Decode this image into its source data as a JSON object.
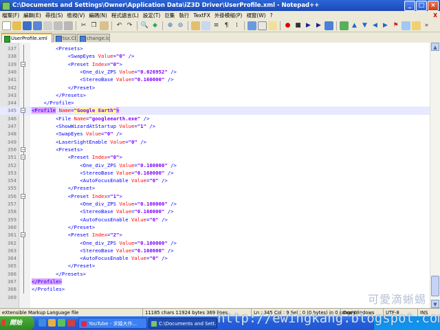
{
  "window": {
    "title": "C:\\Documents and Settings\\Owner\\Application Data\\iZ3D Driver\\UserProfile.xml - Notepad++"
  },
  "menu": {
    "items": [
      "檔案(F)",
      "編輯(E)",
      "尋找(S)",
      "檢視(V)",
      "編碼(N)",
      "程式語言(L)",
      "設定(T)",
      "巨集",
      "執行",
      "TextFX",
      "外掛模組(P)",
      "視窗(W)",
      "?"
    ],
    "close_label": "X"
  },
  "tabs": [
    {
      "label": "UserProfile.xml",
      "active": true
    },
    {
      "label": "tsx.CFG",
      "active": false
    },
    {
      "label": "change.log",
      "active": false
    }
  ],
  "editor": {
    "current_line": 345,
    "lines": [
      {
        "num": 337,
        "segs": [
          {
            "c": "t",
            "x": "        <Presets>"
          }
        ]
      },
      {
        "num": 338,
        "segs": [
          {
            "c": "t",
            "x": "            <SwapEyes "
          },
          {
            "c": "a",
            "x": "Value"
          },
          {
            "c": "t",
            "x": "="
          },
          {
            "c": "v",
            "x": "\"0\""
          },
          {
            "c": "t",
            "x": " />"
          }
        ]
      },
      {
        "num": 339,
        "segs": [
          {
            "c": "t",
            "x": "            <Preset "
          },
          {
            "c": "a",
            "x": "Index"
          },
          {
            "c": "t",
            "x": "="
          },
          {
            "c": "v",
            "x": "\"0\""
          },
          {
            "c": "t",
            "x": ">"
          }
        ]
      },
      {
        "num": 340,
        "segs": [
          {
            "c": "t",
            "x": "                <One_div_ZPS "
          },
          {
            "c": "a",
            "x": "Value"
          },
          {
            "c": "t",
            "x": "="
          },
          {
            "c": "v",
            "x": "\"0.026952\""
          },
          {
            "c": "t",
            "x": " />"
          }
        ]
      },
      {
        "num": 341,
        "segs": [
          {
            "c": "t",
            "x": "                <StereoBase "
          },
          {
            "c": "a",
            "x": "Value"
          },
          {
            "c": "t",
            "x": "="
          },
          {
            "c": "v",
            "x": "\"0.160000\""
          },
          {
            "c": "t",
            "x": " />"
          }
        ]
      },
      {
        "num": 342,
        "segs": [
          {
            "c": "t",
            "x": "            </Preset>"
          }
        ]
      },
      {
        "num": 343,
        "segs": [
          {
            "c": "t",
            "x": "        </Presets>"
          }
        ]
      },
      {
        "num": 344,
        "segs": [
          {
            "c": "t",
            "x": "    </Profile>"
          }
        ]
      },
      {
        "num": 345,
        "segs": [
          {
            "c": "th",
            "x": "<Profile"
          },
          {
            "c": "t",
            "x": " "
          },
          {
            "c": "a",
            "x": "Name"
          },
          {
            "c": "t",
            "x": "="
          },
          {
            "c": "vh",
            "x": "\"Google Earth\""
          },
          {
            "c": "th",
            "x": ">"
          }
        ]
      },
      {
        "num": 346,
        "segs": [
          {
            "c": "t",
            "x": "        <File "
          },
          {
            "c": "a",
            "x": "Name"
          },
          {
            "c": "t",
            "x": "="
          },
          {
            "c": "v",
            "x": "\"googleearth.exe\""
          },
          {
            "c": "t",
            "x": " />"
          }
        ]
      },
      {
        "num": 347,
        "segs": [
          {
            "c": "t",
            "x": "        <ShowWizardAtStartup "
          },
          {
            "c": "a",
            "x": "Value"
          },
          {
            "c": "t",
            "x": "="
          },
          {
            "c": "v",
            "x": "\"1\""
          },
          {
            "c": "t",
            "x": " />"
          }
        ]
      },
      {
        "num": 348,
        "segs": [
          {
            "c": "t",
            "x": "        <SwapEyes "
          },
          {
            "c": "a",
            "x": "Value"
          },
          {
            "c": "t",
            "x": "="
          },
          {
            "c": "v",
            "x": "\"0\""
          },
          {
            "c": "t",
            "x": " />"
          }
        ]
      },
      {
        "num": 349,
        "segs": [
          {
            "c": "t",
            "x": "        <LaserSightEnable "
          },
          {
            "c": "a",
            "x": "Value"
          },
          {
            "c": "t",
            "x": "="
          },
          {
            "c": "v",
            "x": "\"0\""
          },
          {
            "c": "t",
            "x": " />"
          }
        ]
      },
      {
        "num": 350,
        "segs": [
          {
            "c": "t",
            "x": "        <Presets>"
          }
        ]
      },
      {
        "num": 351,
        "segs": [
          {
            "c": "t",
            "x": "            <Preset "
          },
          {
            "c": "a",
            "x": "Index"
          },
          {
            "c": "t",
            "x": "="
          },
          {
            "c": "v",
            "x": "\"0\""
          },
          {
            "c": "t",
            "x": ">"
          }
        ]
      },
      {
        "num": 352,
        "segs": [
          {
            "c": "t",
            "x": "                <One_div_ZPS "
          },
          {
            "c": "a",
            "x": "Value"
          },
          {
            "c": "t",
            "x": "="
          },
          {
            "c": "v",
            "x": "\"0.100000\""
          },
          {
            "c": "t",
            "x": " />"
          }
        ]
      },
      {
        "num": 353,
        "segs": [
          {
            "c": "t",
            "x": "                <StereoBase "
          },
          {
            "c": "a",
            "x": "Value"
          },
          {
            "c": "t",
            "x": "="
          },
          {
            "c": "v",
            "x": "\"0.160000\""
          },
          {
            "c": "t",
            "x": " />"
          }
        ]
      },
      {
        "num": 354,
        "segs": [
          {
            "c": "t",
            "x": "                <AutoFocusEnable "
          },
          {
            "c": "a",
            "x": "Value"
          },
          {
            "c": "t",
            "x": "="
          },
          {
            "c": "v",
            "x": "\"0\""
          },
          {
            "c": "t",
            "x": " />"
          }
        ]
      },
      {
        "num": 355,
        "segs": [
          {
            "c": "t",
            "x": "            </Preset>"
          }
        ]
      },
      {
        "num": 356,
        "segs": [
          {
            "c": "t",
            "x": "            <Preset "
          },
          {
            "c": "a",
            "x": "Index"
          },
          {
            "c": "t",
            "x": "="
          },
          {
            "c": "v",
            "x": "\"1\""
          },
          {
            "c": "t",
            "x": ">"
          }
        ]
      },
      {
        "num": 357,
        "segs": [
          {
            "c": "t",
            "x": "                <One_div_ZPS "
          },
          {
            "c": "a",
            "x": "Value"
          },
          {
            "c": "t",
            "x": "="
          },
          {
            "c": "v",
            "x": "\"0.100000\""
          },
          {
            "c": "t",
            "x": " />"
          }
        ]
      },
      {
        "num": 358,
        "segs": [
          {
            "c": "t",
            "x": "                <StereoBase "
          },
          {
            "c": "a",
            "x": "Value"
          },
          {
            "c": "t",
            "x": "="
          },
          {
            "c": "v",
            "x": "\"0.160000\""
          },
          {
            "c": "t",
            "x": " />"
          }
        ]
      },
      {
        "num": 359,
        "segs": [
          {
            "c": "t",
            "x": "                <AutoFocusEnable "
          },
          {
            "c": "a",
            "x": "Value"
          },
          {
            "c": "t",
            "x": "="
          },
          {
            "c": "v",
            "x": "\"0\""
          },
          {
            "c": "t",
            "x": " />"
          }
        ]
      },
      {
        "num": 360,
        "segs": [
          {
            "c": "t",
            "x": "            </Preset>"
          }
        ]
      },
      {
        "num": 361,
        "segs": [
          {
            "c": "t",
            "x": "            <Preset "
          },
          {
            "c": "a",
            "x": "Index"
          },
          {
            "c": "t",
            "x": "="
          },
          {
            "c": "v",
            "x": "\"2\""
          },
          {
            "c": "t",
            "x": ">"
          }
        ]
      },
      {
        "num": 362,
        "segs": [
          {
            "c": "t",
            "x": "                <One_div_ZPS "
          },
          {
            "c": "a",
            "x": "Value"
          },
          {
            "c": "t",
            "x": "="
          },
          {
            "c": "v",
            "x": "\"0.100000\""
          },
          {
            "c": "t",
            "x": " />"
          }
        ]
      },
      {
        "num": 363,
        "segs": [
          {
            "c": "t",
            "x": "                <StereoBase "
          },
          {
            "c": "a",
            "x": "Value"
          },
          {
            "c": "t",
            "x": "="
          },
          {
            "c": "v",
            "x": "\"0.160000\""
          },
          {
            "c": "t",
            "x": " />"
          }
        ]
      },
      {
        "num": 364,
        "segs": [
          {
            "c": "t",
            "x": "                <AutoFocusEnable "
          },
          {
            "c": "a",
            "x": "Value"
          },
          {
            "c": "t",
            "x": "="
          },
          {
            "c": "v",
            "x": "\"0\""
          },
          {
            "c": "t",
            "x": " />"
          }
        ]
      },
      {
        "num": 365,
        "segs": [
          {
            "c": "t",
            "x": "            </Preset>"
          }
        ]
      },
      {
        "num": 366,
        "segs": [
          {
            "c": "t",
            "x": "        </Presets>"
          }
        ]
      },
      {
        "num": 367,
        "segs": [
          {
            "c": "th",
            "x": "</Profile>"
          }
        ]
      },
      {
        "num": 368,
        "segs": [
          {
            "c": "t",
            "x": "</Profiles>"
          }
        ]
      },
      {
        "num": 369,
        "segs": []
      }
    ]
  },
  "statusbar": {
    "filetype": "eXtensible Markup Language file",
    "size": "11185 chars   11924 bytes   369 lines",
    "position": "Ln : 345    Col : 9    Sel : 0 (0 bytes) in 0 ranges",
    "eol": "Dos\\Windows",
    "encoding": "UTF-8",
    "mode": "INS"
  },
  "taskbar": {
    "start_label": "開始",
    "buttons": [
      {
        "label": "YouTube - 求婚大作..."
      },
      {
        "label": "C:\\Documents and Sett..."
      }
    ]
  },
  "watermark": {
    "text": "可愛滴蜥蜴",
    "url": "http://ewingkang.blogspot.com"
  },
  "colors": {
    "tag": "#0000ff",
    "attribute": "#ff0000",
    "value": "#8000ff",
    "current_line": "#e8e8ff",
    "matched_tag": "#e0a0ff"
  }
}
